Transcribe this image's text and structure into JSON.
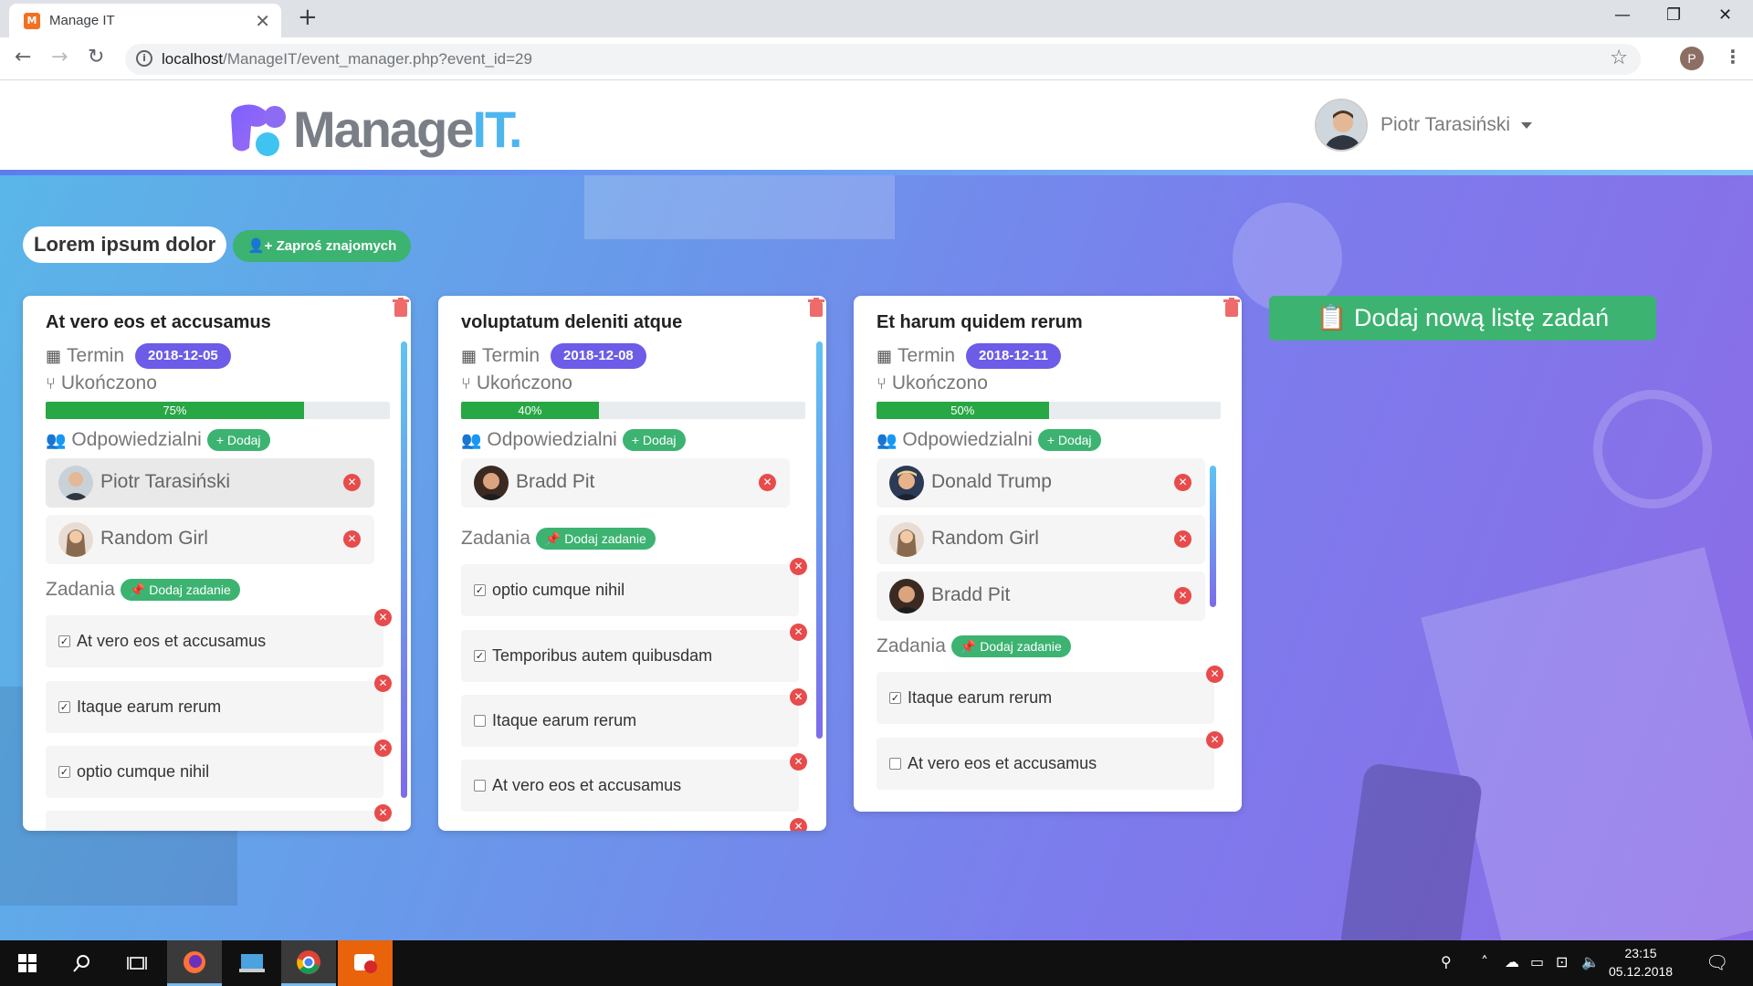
{
  "browser": {
    "tab_title": "Manage IT",
    "tab_close": "✕",
    "new_tab": "+",
    "url_host": "localhost",
    "url_path": "/ManageIT/event_manager.php?event_id=29",
    "profile_initial": "P"
  },
  "header": {
    "logo_text_main": "Manage",
    "logo_text_accent": "IT.",
    "user_name": "Piotr Tarasiński"
  },
  "event": {
    "title": "Lorem ipsum dolor",
    "invite_label": "Zaproś znajomych",
    "add_list_label": "Dodaj nową listę zadań"
  },
  "labels": {
    "deadline": "Termin",
    "completed": "Ukończono",
    "responsible": "Odpowiedzialni",
    "add": "Dodaj",
    "tasks": "Zadania",
    "add_task": "Dodaj zadanie"
  },
  "lists": [
    {
      "title": "At vero eos et accusamus",
      "date": "2018-12-05",
      "progress": 75,
      "progress_label": "75%",
      "people": [
        {
          "name": "Piotr Tarasiński"
        },
        {
          "name": "Random Girl"
        }
      ],
      "tasks": [
        {
          "text": "At vero eos et accusamus",
          "done": true
        },
        {
          "text": "Itaque earum rerum",
          "done": true
        },
        {
          "text": "optio cumque nihil",
          "done": true
        }
      ]
    },
    {
      "title": "voluptatum deleniti atque",
      "date": "2018-12-08",
      "progress": 40,
      "progress_label": "40%",
      "people": [
        {
          "name": "Bradd Pit"
        }
      ],
      "tasks": [
        {
          "text": "optio cumque nihil",
          "done": true
        },
        {
          "text": "Temporibus autem quibusdam",
          "done": true
        },
        {
          "text": "Itaque earum rerum",
          "done": false
        },
        {
          "text": "At vero eos et accusamus",
          "done": false
        }
      ]
    },
    {
      "title": "Et harum quidem rerum",
      "date": "2018-12-11",
      "progress": 50,
      "progress_label": "50%",
      "people": [
        {
          "name": "Donald Trump"
        },
        {
          "name": "Random Girl"
        },
        {
          "name": "Bradd Pit"
        }
      ],
      "tasks": [
        {
          "text": "Itaque earum rerum",
          "done": true
        },
        {
          "text": "At vero eos et accusamus",
          "done": false
        }
      ]
    }
  ],
  "taskbar": {
    "time": "23:15",
    "date": "05.12.2018"
  },
  "colors": {
    "accent_green": "#3cb371",
    "date_badge": "#6c5ce7",
    "progress_green": "#28a745",
    "delete_red": "#e84b4b"
  }
}
